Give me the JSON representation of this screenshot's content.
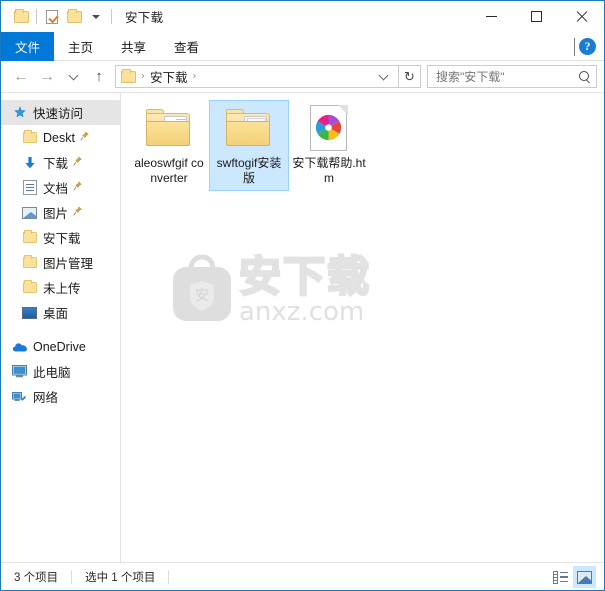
{
  "window": {
    "title": "安下载",
    "controls": {
      "minimize": "minimize-icon",
      "maximize": "maximize-icon",
      "close": "close-icon"
    },
    "quick_access": [
      {
        "icon": "folder-icon",
        "name": "qat-folder"
      },
      {
        "icon": "checked-document-icon",
        "name": "qat-properties"
      },
      {
        "icon": "folder-icon",
        "name": "qat-new-folder"
      },
      {
        "icon": "chevron-down-icon",
        "name": "qat-customize"
      }
    ]
  },
  "ribbon": {
    "tabs": [
      {
        "label": "文件",
        "active": true
      },
      {
        "label": "主页",
        "active": false
      },
      {
        "label": "共享",
        "active": false
      },
      {
        "label": "查看",
        "active": false
      }
    ],
    "expand_icon": "chevron-down-icon",
    "help_icon": "help-icon",
    "help_glyph": "?"
  },
  "navbar": {
    "back": "←",
    "forward": "→",
    "recent": "chevron-down-icon",
    "up": "↑",
    "breadcrumb": {
      "folder_icon": "folder-icon",
      "separator": "›",
      "path": [
        "安下载"
      ],
      "dropdown": "chevron-down-icon"
    },
    "refresh": "↻",
    "search": {
      "placeholder": "搜索\"安下载\"",
      "icon": "search-icon"
    }
  },
  "sidebar": {
    "items": [
      {
        "label": "快速访问",
        "icon": "star-pin-icon",
        "selected": true,
        "indent": 0,
        "pinned": false
      },
      {
        "label": "Deskt",
        "icon": "folder-icon",
        "selected": false,
        "indent": 1,
        "pinned": true
      },
      {
        "label": "下载",
        "icon": "download-icon",
        "selected": false,
        "indent": 1,
        "pinned": true
      },
      {
        "label": "文档",
        "icon": "documents-icon",
        "selected": false,
        "indent": 1,
        "pinned": true
      },
      {
        "label": "图片",
        "icon": "pictures-icon",
        "selected": false,
        "indent": 1,
        "pinned": true
      },
      {
        "label": "安下载",
        "icon": "folder-icon",
        "selected": false,
        "indent": 1,
        "pinned": false
      },
      {
        "label": "图片管理",
        "icon": "folder-icon",
        "selected": false,
        "indent": 1,
        "pinned": false
      },
      {
        "label": "未上传",
        "icon": "folder-icon",
        "selected": false,
        "indent": 1,
        "pinned": false
      },
      {
        "label": "桌面",
        "icon": "desktop-icon",
        "selected": false,
        "indent": 1,
        "pinned": false
      },
      {
        "label": "OneDrive",
        "icon": "cloud-icon",
        "selected": false,
        "indent": 0,
        "pinned": false
      },
      {
        "label": "此电脑",
        "icon": "computer-icon",
        "selected": false,
        "indent": 0,
        "pinned": false
      },
      {
        "label": "网络",
        "icon": "network-icon",
        "selected": false,
        "indent": 0,
        "pinned": false
      }
    ]
  },
  "content": {
    "files": [
      {
        "name": "aleoswfgif converter",
        "type": "folder",
        "selected": false
      },
      {
        "name": "swftogif安装版",
        "type": "folder",
        "selected": true
      },
      {
        "name": "安下载帮助.htm",
        "type": "htm",
        "selected": false
      }
    ],
    "watermark": {
      "badge_char": "安",
      "brand": "安下载",
      "url": "anxz.com"
    }
  },
  "statusbar": {
    "item_count": "3 个项目",
    "selection": "选中 1 个项目",
    "views": [
      {
        "name": "details-view-icon",
        "active": false
      },
      {
        "name": "large-icons-view-icon",
        "active": true
      }
    ]
  },
  "colors": {
    "accent": "#0078d7",
    "selection_bg": "#cce8ff",
    "selection_border": "#99d1ff",
    "folder_yellow": "#fbe199",
    "window_border": "#1a7bbf"
  }
}
